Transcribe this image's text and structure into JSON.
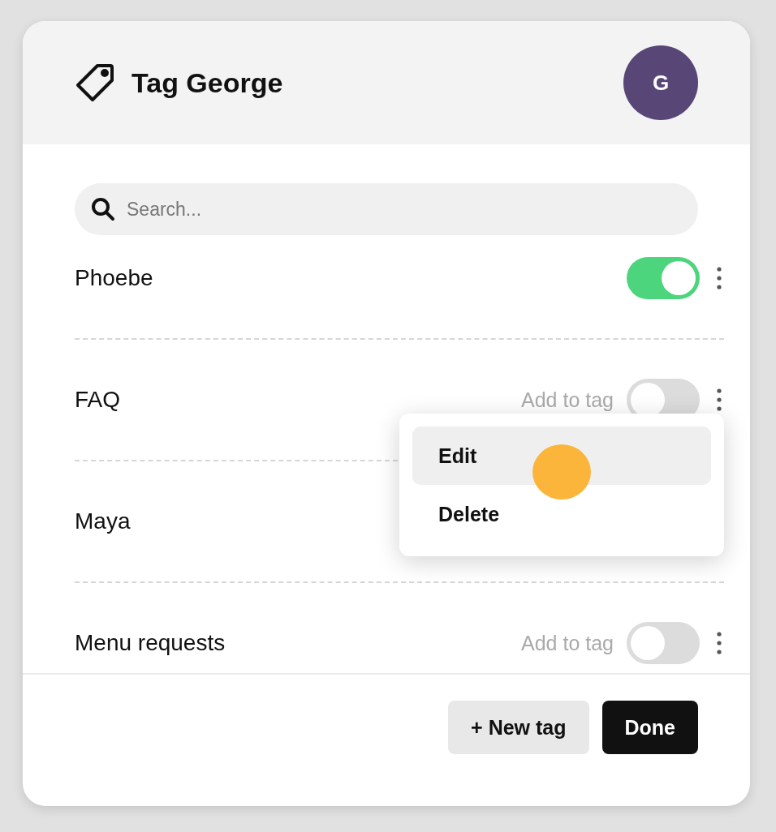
{
  "dialog": {
    "title": "Tag George",
    "avatar": "G",
    "search": {
      "placeholder": "Search..."
    },
    "tags": [
      {
        "name": "Phoebe",
        "on": true
      },
      {
        "name": "FAQ",
        "hint": "Add to tag",
        "on": false
      },
      {
        "name": "Maya"
      },
      {
        "name": "Menu requests",
        "hint": "Add to tag",
        "on": false
      }
    ],
    "menu": {
      "items": [
        {
          "label": "Edit",
          "selected": true
        },
        {
          "label": "Delete",
          "selected": false
        }
      ]
    },
    "buttons": [
      {
        "label": "+ New tag",
        "kind": "secondary"
      },
      {
        "label": "Done",
        "kind": "primary"
      }
    ]
  }
}
